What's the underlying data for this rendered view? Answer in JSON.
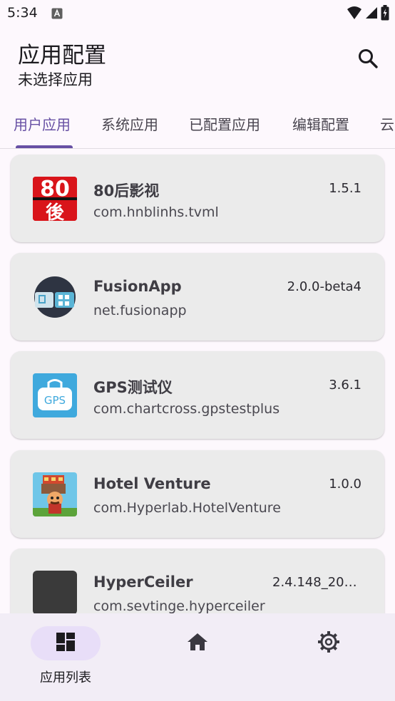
{
  "status_bar": {
    "time": "5:34"
  },
  "app_bar": {
    "title": "应用配置",
    "subtitle": "未选择应用"
  },
  "tabs": [
    {
      "label": "用户应用"
    },
    {
      "label": "系统应用"
    },
    {
      "label": "已配置应用"
    },
    {
      "label": "编辑配置"
    },
    {
      "label": "云"
    }
  ],
  "apps": [
    {
      "name": "80后影视",
      "package": "com.hnblinhs.tvml",
      "version": "1.5.1",
      "icon_text": "80",
      "icon_text2": "後"
    },
    {
      "name": "FusionApp",
      "package": "net.fusionapp",
      "version": "2.0.0-beta4"
    },
    {
      "name": "GPS测试仪",
      "package": "com.chartcross.gpstestplus",
      "version": "3.6.1",
      "icon_text": "GPS"
    },
    {
      "name": "Hotel Venture",
      "package": "com.Hyperlab.HotelVenture",
      "version": "1.0.0"
    },
    {
      "name": "HyperCeiler",
      "package": "com.sevtinge.hyperceiler",
      "version": "2.4.148_202..."
    }
  ],
  "bottom_nav": [
    {
      "label": "应用列表",
      "icon": "dashboard-icon"
    },
    {
      "icon": "home-icon"
    },
    {
      "icon": "settings-icon"
    }
  ],
  "colors": {
    "accent": "#6750A4",
    "card": "#EBEBEB",
    "nav_bg": "#F2EDF6",
    "nav_pill": "#E8DEF8"
  }
}
